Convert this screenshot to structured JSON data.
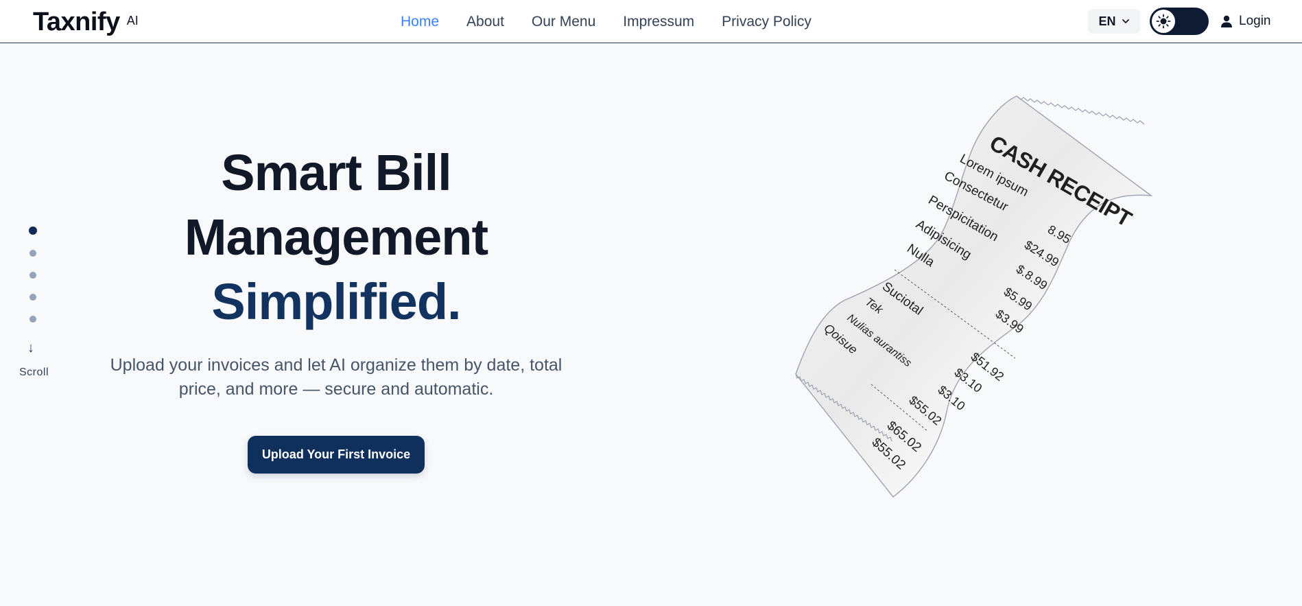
{
  "brand": {
    "name": "Taxnify",
    "suffix": "AI"
  },
  "nav": {
    "items": [
      {
        "label": "Home",
        "active": true
      },
      {
        "label": "About",
        "active": false
      },
      {
        "label": "Our Menu",
        "active": false
      },
      {
        "label": "Impressum",
        "active": false
      },
      {
        "label": "Privacy Policy",
        "active": false
      }
    ]
  },
  "header": {
    "language": "EN",
    "theme_icon": "sun-icon",
    "login_label": "Login"
  },
  "side": {
    "dots": 5,
    "active_dot": 0,
    "scroll_label": "Scroll",
    "scroll_arrow": "↓"
  },
  "hero": {
    "title_line1": "Smart Bill",
    "title_line2": "Management",
    "title_line3": "Simplified.",
    "subtitle": "Upload your invoices and let AI organize them by date, total price, and more — secure and automatic.",
    "cta_label": "Upload Your First Invoice"
  },
  "receipt": {
    "title": "CASH RECEIPT",
    "items": [
      {
        "label": "Lorem ipsum",
        "value": ""
      },
      {
        "label": "Consectetur",
        "value": "8.95"
      },
      {
        "label": "Perspicitation",
        "value": "$24.99"
      },
      {
        "label": "Adipisicing",
        "value": "$.8.99"
      },
      {
        "label": "Nulla",
        "value": "$5.99"
      },
      {
        "label": "",
        "value": "$3.99"
      }
    ],
    "totals": [
      {
        "label": "Suciotal",
        "value": "$51.92"
      },
      {
        "label": "Tek",
        "value": "$3.10"
      },
      {
        "label": "Nulias aurantiss",
        "value": "$3.10"
      },
      {
        "label": "Qoisue",
        "value": "$55.02"
      }
    ],
    "final": [
      "$65.02",
      "$55.02"
    ]
  },
  "colors": {
    "accent": "#3b82f6",
    "brand_dark": "#0f2f5c",
    "title_accent": "#12335f"
  }
}
